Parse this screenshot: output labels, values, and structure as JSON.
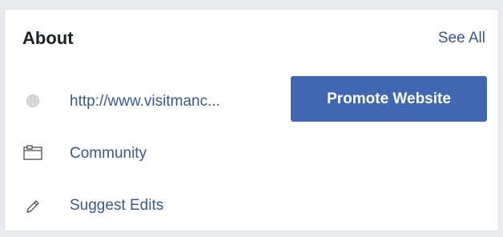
{
  "about": {
    "title": "About",
    "see_all_label": "See All"
  },
  "website": {
    "icon": "globe-icon",
    "url_text": "http://www.visitmanc..."
  },
  "promote": {
    "label": "Promote Website",
    "color": "#4267b2"
  },
  "category": {
    "icon": "page-category-icon",
    "label": "Community"
  },
  "suggest": {
    "icon": "pencil-icon",
    "label": "Suggest Edits"
  },
  "colors": {
    "link": "#365899",
    "heading": "#1d2129",
    "icon": "#90949c"
  }
}
